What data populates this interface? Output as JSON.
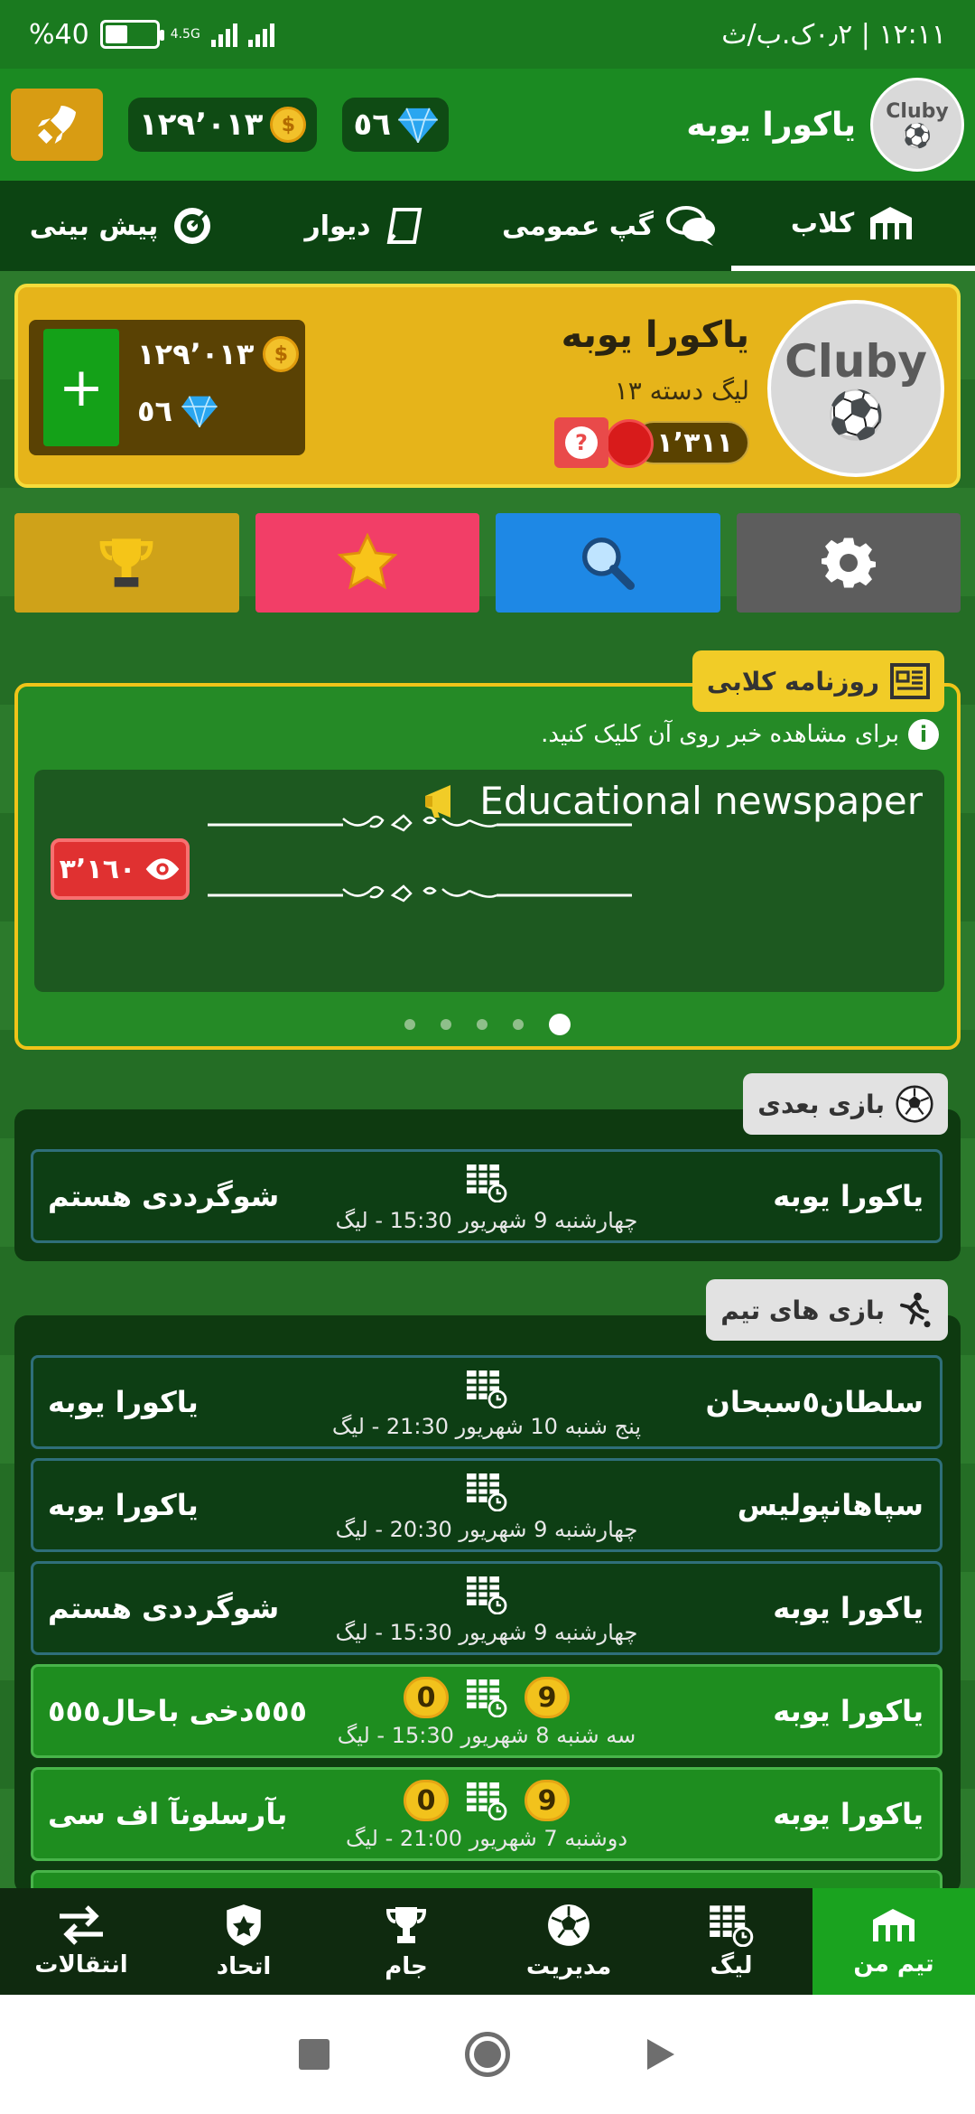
{
  "status": {
    "battery": "%40",
    "network": "4.5G",
    "time": "١٢:١١ | ٠٫٢ک.ب/ث"
  },
  "topbar": {
    "coins": "١٢٩٬٠١٣",
    "gems": "٥٦",
    "team_name": "یاکورا یوبه",
    "logo_text": "Cluby"
  },
  "tabs": [
    {
      "label": "کلاب"
    },
    {
      "label": "گپ عمومی"
    },
    {
      "label": "دیوار"
    },
    {
      "label": "پیش بینی"
    }
  ],
  "club": {
    "name": "یاکورا یوبه",
    "league": "لیگ دسته ۱۳",
    "rank": "۱٬۳۱۱",
    "help": "?",
    "coins": "١٢٩٬٠١٣",
    "gems": "٥٦",
    "add": "+",
    "logo_text": "Cluby"
  },
  "newspaper": {
    "tag": "روزنامه کلابی",
    "hint": "برای مشاهده خبر روی آن کلیک کنید.",
    "info": "i",
    "title": "Educational newspaper",
    "views": "٣٬١٦٠",
    "ornament": "ـــــــــــــــ৲৹♡৹৲ــــــــــــــــ",
    "pages": 5,
    "active_page": 5
  },
  "next_match": {
    "tag": "بازی بعدی",
    "home": "یاکورا یوبه",
    "away": "شوگرددی هستم",
    "when": "چهارشنبه 9 شهریور 15:30 - لیگ"
  },
  "team_matches": {
    "tag": "بازی های تیم",
    "items": [
      {
        "home": "سلطان٥سبحان",
        "away": "یاکورا یوبه",
        "when": "پنج شنبه 10 شهریور 21:30 - لیگ",
        "played": false
      },
      {
        "home": "سپاهانپولیس",
        "away": "یاکورا یوبه",
        "when": "چهارشنبه 9 شهریور 20:30 - لیگ",
        "played": false
      },
      {
        "home": "یاکورا یوبه",
        "away": "شوگرددی هستم",
        "when": "چهارشنبه 9 شهریور 15:30 - لیگ",
        "played": false
      },
      {
        "home": "یاکورا یوبه",
        "away": "٥٥٥دخی باحال٥٥٥",
        "when": "سه شنبه 8 شهریور 15:30 - لیگ",
        "played": true,
        "home_score": "9",
        "away_score": "0"
      },
      {
        "home": "یاکورا یوبه",
        "away": "بآرسلونآ اف سی",
        "when": "دوشنبه 7 شهریور 21:00 - لیگ",
        "played": true,
        "home_score": "9",
        "away_score": "0"
      }
    ]
  },
  "bottom_nav": [
    {
      "label": "تیم من"
    },
    {
      "label": "لیگ"
    },
    {
      "label": "مدیریت"
    },
    {
      "label": "جام"
    },
    {
      "label": "اتحاد"
    },
    {
      "label": "انتقالات"
    }
  ],
  "colors": {
    "primary_green": "#1b8a22",
    "gold": "#e6b41a",
    "accent_red": "#e94a4a",
    "blue": "#1e88e5"
  }
}
